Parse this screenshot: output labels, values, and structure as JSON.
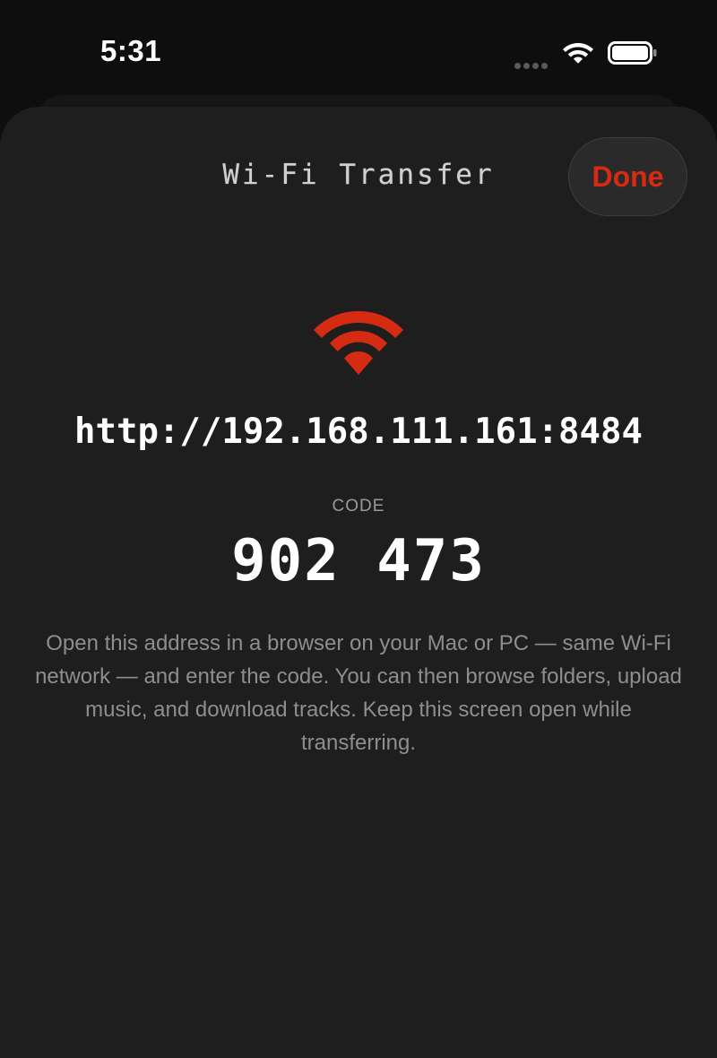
{
  "status_bar": {
    "time": "5:31",
    "wifi_icon": "wifi-icon",
    "battery_icon": "battery-icon",
    "signal_icon": "cellular-signal-dots-icon"
  },
  "sheet": {
    "title": "Wi-Fi Transfer",
    "done_label": "Done",
    "hero_icon": "wifi-icon",
    "address": "http://192.168.111.161:8484",
    "code_label": "CODE",
    "code_value": "902 473",
    "instructions": "Open this address in a browser on your Mac or PC — same Wi-Fi network — and enter the code. You can then browse folders, upload music, and download tracks. Keep this screen open while transferring."
  },
  "colors": {
    "accent": "#d52b12",
    "sheet_background": "#1e1e1e",
    "screen_background": "#0e0e0e",
    "secondary_text": "#8e8e8e"
  }
}
